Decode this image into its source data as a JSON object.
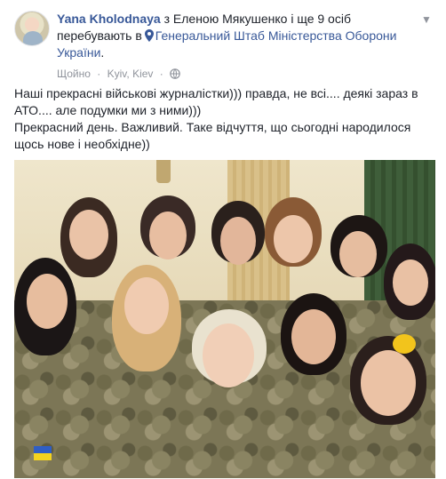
{
  "post": {
    "author": "Yana Kholodnaya",
    "with_text": "з Еленою Мякушенко і ще 9 осіб",
    "location_prefix": "перебувають в",
    "location_name": "Генеральний Штаб Міністерства Оборони України",
    "location_suffix": ".",
    "timestamp": "Щойно",
    "separator": "·",
    "place": "Kyiv, Kiev",
    "privacy_icon": "globe-icon",
    "menu_icon": "chevron-down-icon",
    "paragraph_1": "Наші прекрасні військові журналістки))) правда, не всі.... деякі зараз в АТО.... але подумки ми з ними)))",
    "paragraph_2": "Прекрасний день. Важливий. Таке відчуття, що сьогодні народилося щось нове і необхідне))"
  },
  "colors": {
    "link": "#385898",
    "text": "#1d2129",
    "muted": "#90949c"
  }
}
